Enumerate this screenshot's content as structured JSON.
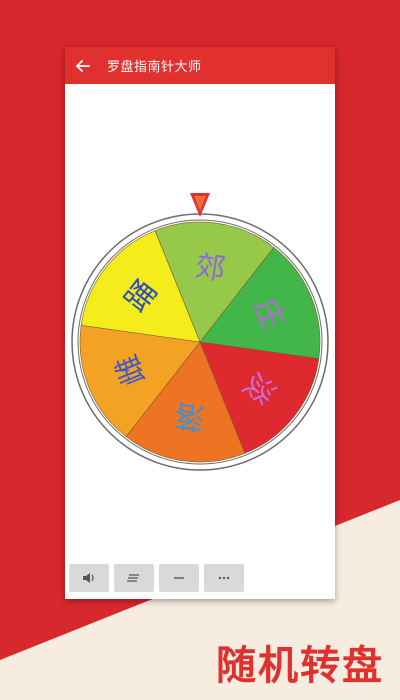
{
  "app_bar": {
    "title": "罗盘指南针大师",
    "back_icon": "arrow-left-icon",
    "color": "#e0312f"
  },
  "wheel": {
    "segments": [
      {
        "label": "郊",
        "color": "#96c94a",
        "text_color": "#8e6ad6"
      },
      {
        "label": "庄",
        "color": "#43b649",
        "text_color": "#b26bd9"
      },
      {
        "label": "淡",
        "color": "#de2a2f",
        "text_color": "#c86bd6"
      },
      {
        "label": "落",
        "color": "#ee7424",
        "text_color": "#3d8fd6"
      },
      {
        "label": "雌",
        "color": "#f4a223",
        "text_color": "#3d58c9"
      },
      {
        "label": "踊",
        "color": "#f5ec1b",
        "text_color": "#2d4fbf"
      }
    ],
    "pointer_color": "#e0312f"
  },
  "toolbar": {
    "buttons": [
      {
        "icon": "volume-icon"
      },
      {
        "icon": "menu-lines-icon"
      },
      {
        "icon": "minus-icon"
      },
      {
        "icon": "more-icon"
      }
    ]
  },
  "caption": "随机转盘",
  "colors": {
    "background_red": "#d6282d",
    "cream": "#f7ece0"
  }
}
